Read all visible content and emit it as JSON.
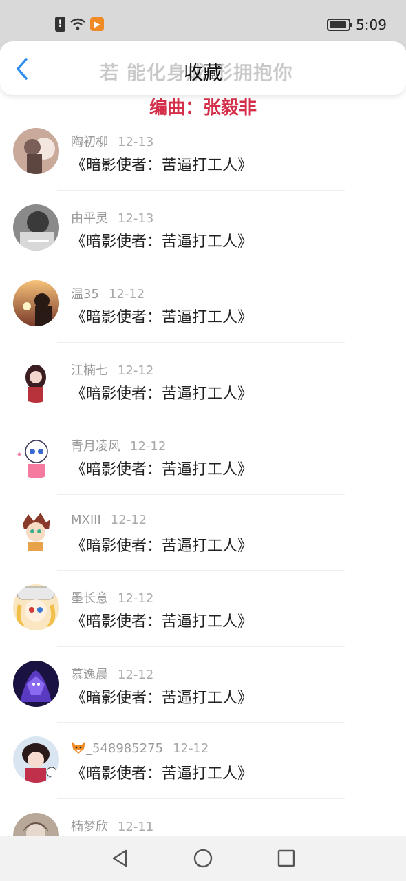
{
  "status": {
    "time": "5:09"
  },
  "header": {
    "title": "收藏",
    "overlay_text": "若 能化身成 形拥抱你"
  },
  "lyric": {
    "credit": "编曲：张毅非"
  },
  "comments": [
    {
      "name": "陶初柳",
      "date": "12-13",
      "text": "《暗影使者：苦逼打工人》"
    },
    {
      "name": "由平灵",
      "date": "12-13",
      "text": "《暗影使者：苦逼打工人》"
    },
    {
      "name": "温35",
      "date": "12-12",
      "text": "《暗影使者：苦逼打工人》"
    },
    {
      "name": "江楠七",
      "date": "12-12",
      "text": "《暗影使者：苦逼打工人》"
    },
    {
      "name": "青月凌风",
      "date": "12-12",
      "text": "《暗影使者：苦逼打工人》"
    },
    {
      "name": "MXIII",
      "date": "12-12",
      "text": "《暗影使者：苦逼打工人》"
    },
    {
      "name": "墨长意",
      "date": "12-12",
      "text": "《暗影使者：苦逼打工人》"
    },
    {
      "name": "慕逸晨",
      "date": "12-12",
      "text": "《暗影使者：苦逼打工人》"
    },
    {
      "name": "_548985275",
      "date": "12-12",
      "text": "《暗影使者：苦逼打工人》"
    },
    {
      "name": "楠梦欣",
      "date": "12-11",
      "text": ""
    }
  ],
  "icons": {
    "back": "chevron-left-icon",
    "nav_back": "triangle-back-icon",
    "nav_home": "circle-home-icon",
    "nav_recent": "square-recents-icon",
    "fox": "fox-emoji-icon"
  },
  "colors": {
    "accent": "#2f8ff0",
    "credit": "#d4304a"
  }
}
